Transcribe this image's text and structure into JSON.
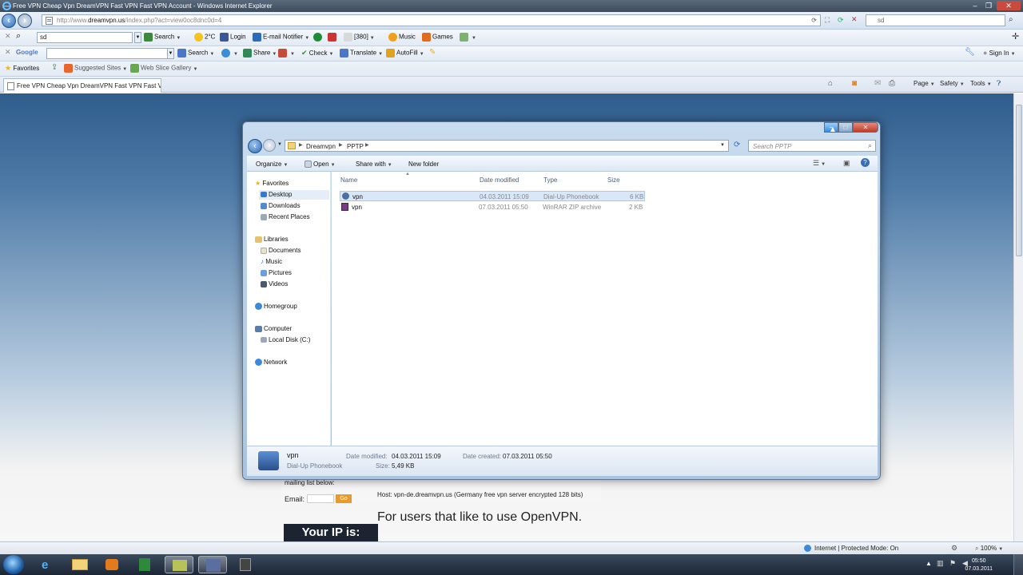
{
  "ie": {
    "title": "Free VPN Cheap Vpn DreamVPN Fast VPN Fast VPN Account - Windows Internet Explorer",
    "url_prefix": "http://www.",
    "url_domain": "dreamvpn.us",
    "url_path": "/index.php?act=view0oc8dnc0d=4",
    "search_placeholder": "sd"
  },
  "toolbar1": {
    "search_value": "sd",
    "search_label": "Search",
    "weather": "2°C",
    "login": "Login",
    "email_notifier": "E-mail Notifier",
    "count": "[380]",
    "music": "Music",
    "games": "Games"
  },
  "toolbar2": {
    "google": "Google",
    "search": "Search",
    "share": "Share",
    "check": "Check",
    "translate": "Translate",
    "autofill": "AutoFill",
    "signin": "Sign In"
  },
  "favbar": {
    "favorites": "Favorites",
    "suggested": "Suggested Sites",
    "webslice": "Web Slice Gallery"
  },
  "commandbar": {
    "page": "Page",
    "safety": "Safety",
    "tools": "Tools"
  },
  "tab": {
    "title": "Free VPN Cheap Vpn DreamVPN Fast VPN Fast V..."
  },
  "explorer": {
    "breadcrumb": [
      "Dreamvpn",
      "PPTP"
    ],
    "search_placeholder": "Search PPTP",
    "cmd": {
      "organize": "Organize",
      "open": "Open",
      "share": "Share with",
      "new_folder": "New folder"
    },
    "nav": {
      "favorites": "Favorites",
      "desktop": "Desktop",
      "downloads": "Downloads",
      "recent": "Recent Places",
      "libraries": "Libraries",
      "documents": "Documents",
      "music": "Music",
      "pictures": "Pictures",
      "videos": "Videos",
      "homegroup": "Homegroup",
      "computer": "Computer",
      "local_disk": "Local Disk (C:)",
      "network": "Network"
    },
    "columns": {
      "name": "Name",
      "date": "Date modified",
      "type": "Type",
      "size": "Size"
    },
    "files": [
      {
        "name": "vpn",
        "date": "04.03.2011 15:09",
        "type": "Dial-Up Phonebook",
        "size": "6 KB"
      },
      {
        "name": "vpn",
        "date": "07.03.2011 05:50",
        "type": "WinRAR ZIP archive",
        "size": "2 KB"
      }
    ],
    "details": {
      "name": "vpn",
      "kind": "Dial-Up Phonebook",
      "date_modified_label": "Date modified:",
      "date_modified": "04.03.2011 15:09",
      "date_created_label": "Date created:",
      "date_created": "07.03.2011 05:50",
      "size_label": "Size:",
      "size": "5,49 KB"
    }
  },
  "webpage": {
    "mailing": "mailing list below:",
    "email_label": "Email:",
    "go": "Go",
    "host_line": "Host: vpn-de.dreamvpn.us (Germany free vpn server encrypted 128 bits)",
    "openvpn": "For users that like to use OpenVPN.",
    "your_ip": "Your IP is:"
  },
  "statusbar": {
    "zone": "Internet | Protected Mode: On",
    "zoom": "100%"
  },
  "taskbar": {
    "time": "05:50",
    "date": "07.03.2011"
  }
}
